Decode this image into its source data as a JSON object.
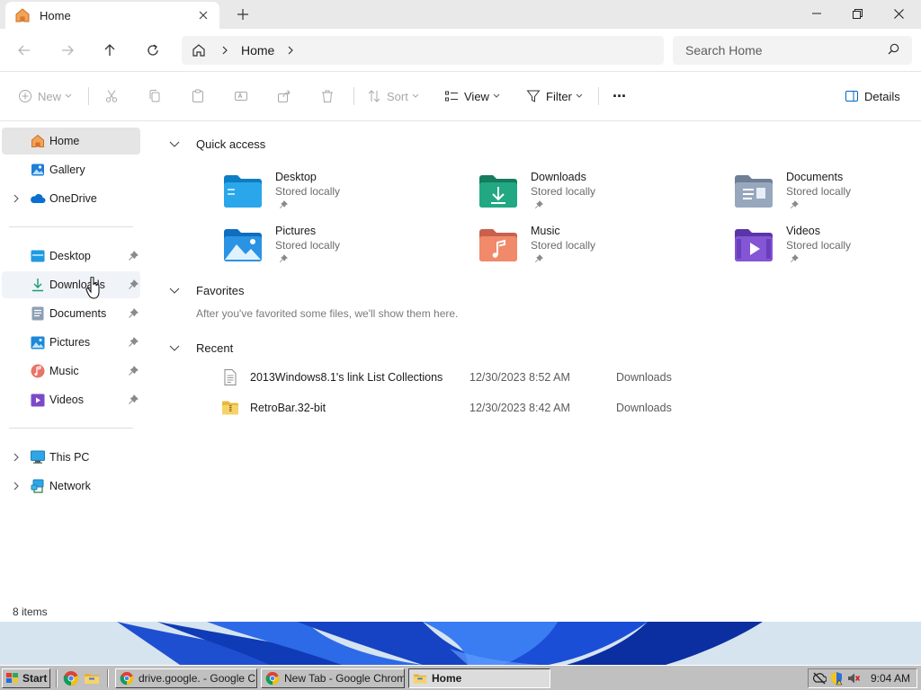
{
  "window": {
    "tab_title": "Home",
    "new_tab_symbol": "+"
  },
  "nav": {
    "breadcrumb": [
      "Home"
    ],
    "search_placeholder": "Search Home"
  },
  "toolbar": {
    "new_label": "New",
    "sort_label": "Sort",
    "view_label": "View",
    "filter_label": "Filter",
    "details_label": "Details",
    "more_symbol": "···"
  },
  "sidebar": {
    "top": [
      {
        "label": "Home",
        "icon": "home-icon",
        "selected": true
      },
      {
        "label": "Gallery",
        "icon": "gallery-icon"
      },
      {
        "label": "OneDrive",
        "icon": "onedrive-icon",
        "expandable": true
      }
    ],
    "pinned": [
      {
        "label": "Desktop",
        "icon": "desktop-folder-icon"
      },
      {
        "label": "Downloads",
        "icon": "downloads-folder-icon"
      },
      {
        "label": "Documents",
        "icon": "documents-folder-icon"
      },
      {
        "label": "Pictures",
        "icon": "pictures-folder-icon"
      },
      {
        "label": "Music",
        "icon": "music-folder-icon"
      },
      {
        "label": "Videos",
        "icon": "videos-folder-icon"
      }
    ],
    "bottom": [
      {
        "label": "This PC",
        "icon": "this-pc-icon",
        "expandable": true
      },
      {
        "label": "Network",
        "icon": "network-icon",
        "expandable": true
      }
    ]
  },
  "status": {
    "item_count": "8 items"
  },
  "quick_access": {
    "title": "Quick access",
    "items": [
      {
        "name": "Desktop",
        "sub": "Stored locally",
        "icon": "desktop-folder-icon"
      },
      {
        "name": "Downloads",
        "sub": "Stored locally",
        "icon": "downloads-folder-icon"
      },
      {
        "name": "Documents",
        "sub": "Stored locally",
        "icon": "documents-folder-icon"
      },
      {
        "name": "Pictures",
        "sub": "Stored locally",
        "icon": "pictures-folder-icon"
      },
      {
        "name": "Music",
        "sub": "Stored locally",
        "icon": "music-folder-icon"
      },
      {
        "name": "Videos",
        "sub": "Stored locally",
        "icon": "videos-folder-icon"
      }
    ]
  },
  "favorites": {
    "title": "Favorites",
    "empty_text": "After you've favorited some files, we'll show them here."
  },
  "recent": {
    "title": "Recent",
    "items": [
      {
        "name": "2013Windows8.1's link List Collections",
        "date": "12/30/2023 8:52 AM",
        "location": "Downloads",
        "icon": "text-file-icon"
      },
      {
        "name": "RetroBar.32-bit",
        "date": "12/30/2023 8:42 AM",
        "location": "Downloads",
        "icon": "zip-folder-icon"
      }
    ]
  },
  "taskbar": {
    "start_label": "Start",
    "tasks": [
      {
        "label": "drive.google. - Google Chr...",
        "icon": "chrome-icon",
        "active": false
      },
      {
        "label": "New Tab - Google Chrome",
        "icon": "chrome-icon",
        "active": false
      },
      {
        "label": "Home",
        "icon": "folder-icon",
        "active": true
      }
    ],
    "clock": "9:04 AM"
  },
  "colors": {
    "accent": "#0067c0",
    "selected_bg": "#e5e5e5",
    "taskbar_gray": "#c0c0c0"
  }
}
